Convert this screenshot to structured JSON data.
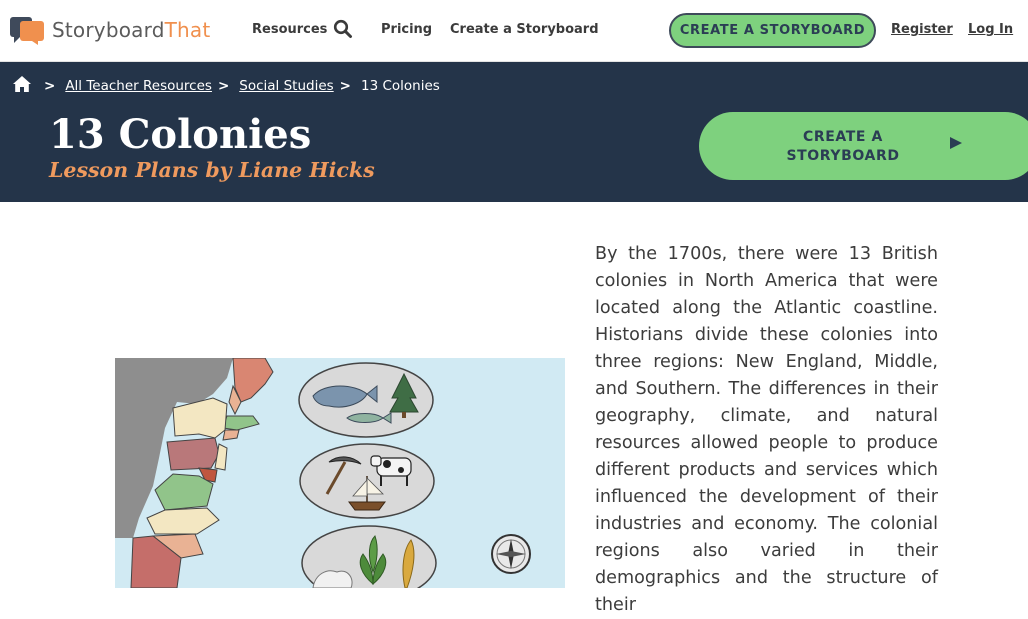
{
  "brand": {
    "name_part1": "Storyboard",
    "name_part2": "That",
    "accent": "#f0904e"
  },
  "nav": {
    "resources": "Resources",
    "search_icon": "search-icon",
    "pricing": "Pricing",
    "create": "Create a Storyboard",
    "cta": "CREATE A STORYBOARD",
    "register": "Register",
    "login": "Log In"
  },
  "breadcrumb": {
    "home_icon": "home-icon",
    "items": [
      "All Teacher Resources",
      "Social Studies",
      "13 Colonies"
    ],
    "separator": ">"
  },
  "hero": {
    "title": "13 Colonies",
    "subtitle": "Lesson Plans by Liane Hicks",
    "cta_line1": "CREATE A",
    "cta_line2": "STORYBOARD",
    "cta_arrow": "play-arrow-icon"
  },
  "content": {
    "paragraph": "By the 1700s, there were 13 British colonies in North America that were located along the Atlantic coastline. Historians divide these colonies into three regions: New England, Middle, and Southern. The differences in their geography, climate, and natural resources allowed people to produce different products and services which influenced the development of their industries and economy. The colonial regions also varied in their demographics and the structure of their"
  },
  "colors": {
    "hero_bg": "#243449",
    "cta_green": "#7ed17e",
    "subtitle_orange": "#ef9a5e"
  }
}
